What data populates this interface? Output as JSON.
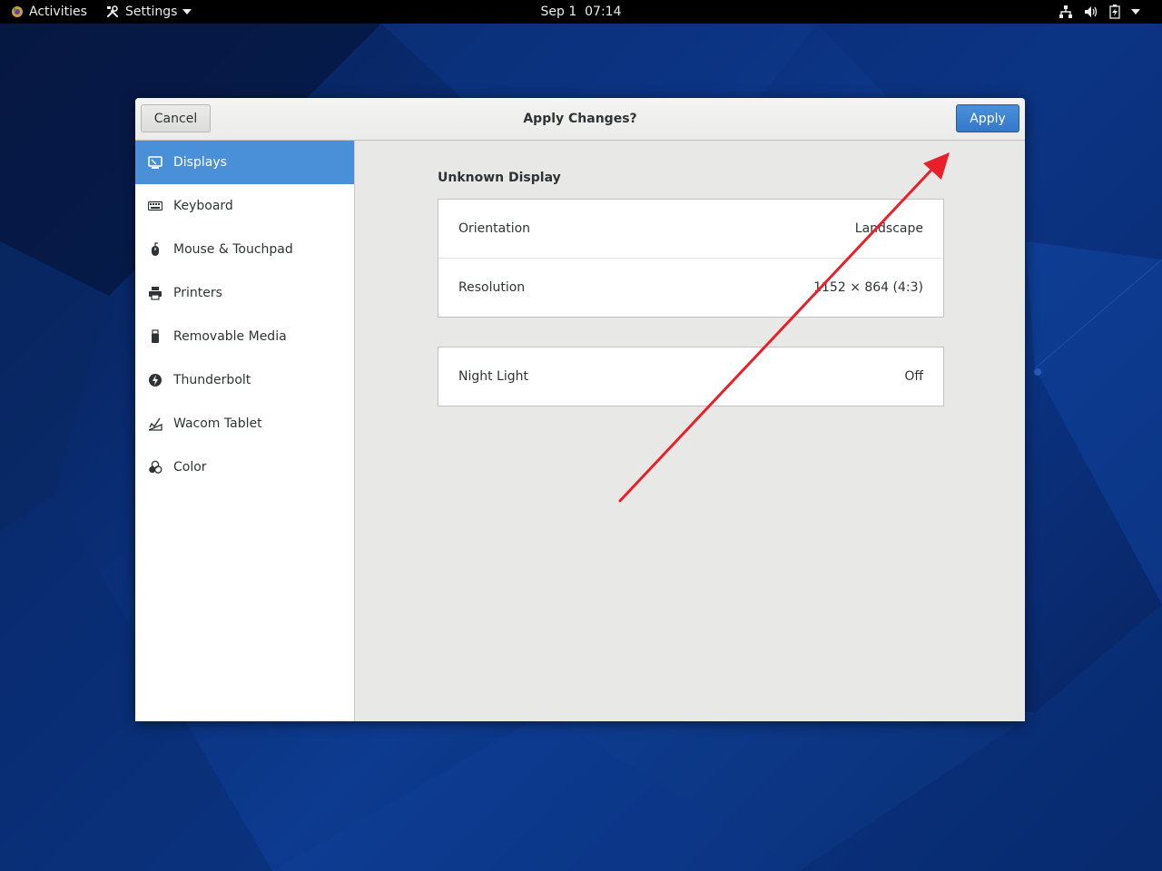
{
  "topbar": {
    "activities": "Activities",
    "app_menu": "Settings",
    "clock": "Sep 1  07:14",
    "status_icons": [
      "network-icon",
      "volume-icon",
      "battery-icon",
      "chevron-down-icon"
    ]
  },
  "window": {
    "title": "Apply Changes?",
    "cancel_label": "Cancel",
    "apply_label": "Apply"
  },
  "sidebar": {
    "items": [
      {
        "label": "Displays",
        "icon": "display-icon",
        "active": true
      },
      {
        "label": "Keyboard",
        "icon": "keyboard-icon"
      },
      {
        "label": "Mouse & Touchpad",
        "icon": "mouse-icon"
      },
      {
        "label": "Printers",
        "icon": "printer-icon"
      },
      {
        "label": "Removable Media",
        "icon": "removable-media-icon"
      },
      {
        "label": "Thunderbolt",
        "icon": "thunderbolt-icon"
      },
      {
        "label": "Wacom Tablet",
        "icon": "wacom-tablet-icon"
      },
      {
        "label": "Color",
        "icon": "color-icon"
      }
    ]
  },
  "display": {
    "section_title": "Unknown Display",
    "orientation_label": "Orientation",
    "orientation_value": "Landscape",
    "resolution_label": "Resolution",
    "resolution_value": "1152 × 864 (4:3)",
    "night_light_label": "Night Light",
    "night_light_value": "Off"
  },
  "colors": {
    "accent": "#4a90d9",
    "annotation_arrow": "#e8202a",
    "topbar": "#000000"
  }
}
